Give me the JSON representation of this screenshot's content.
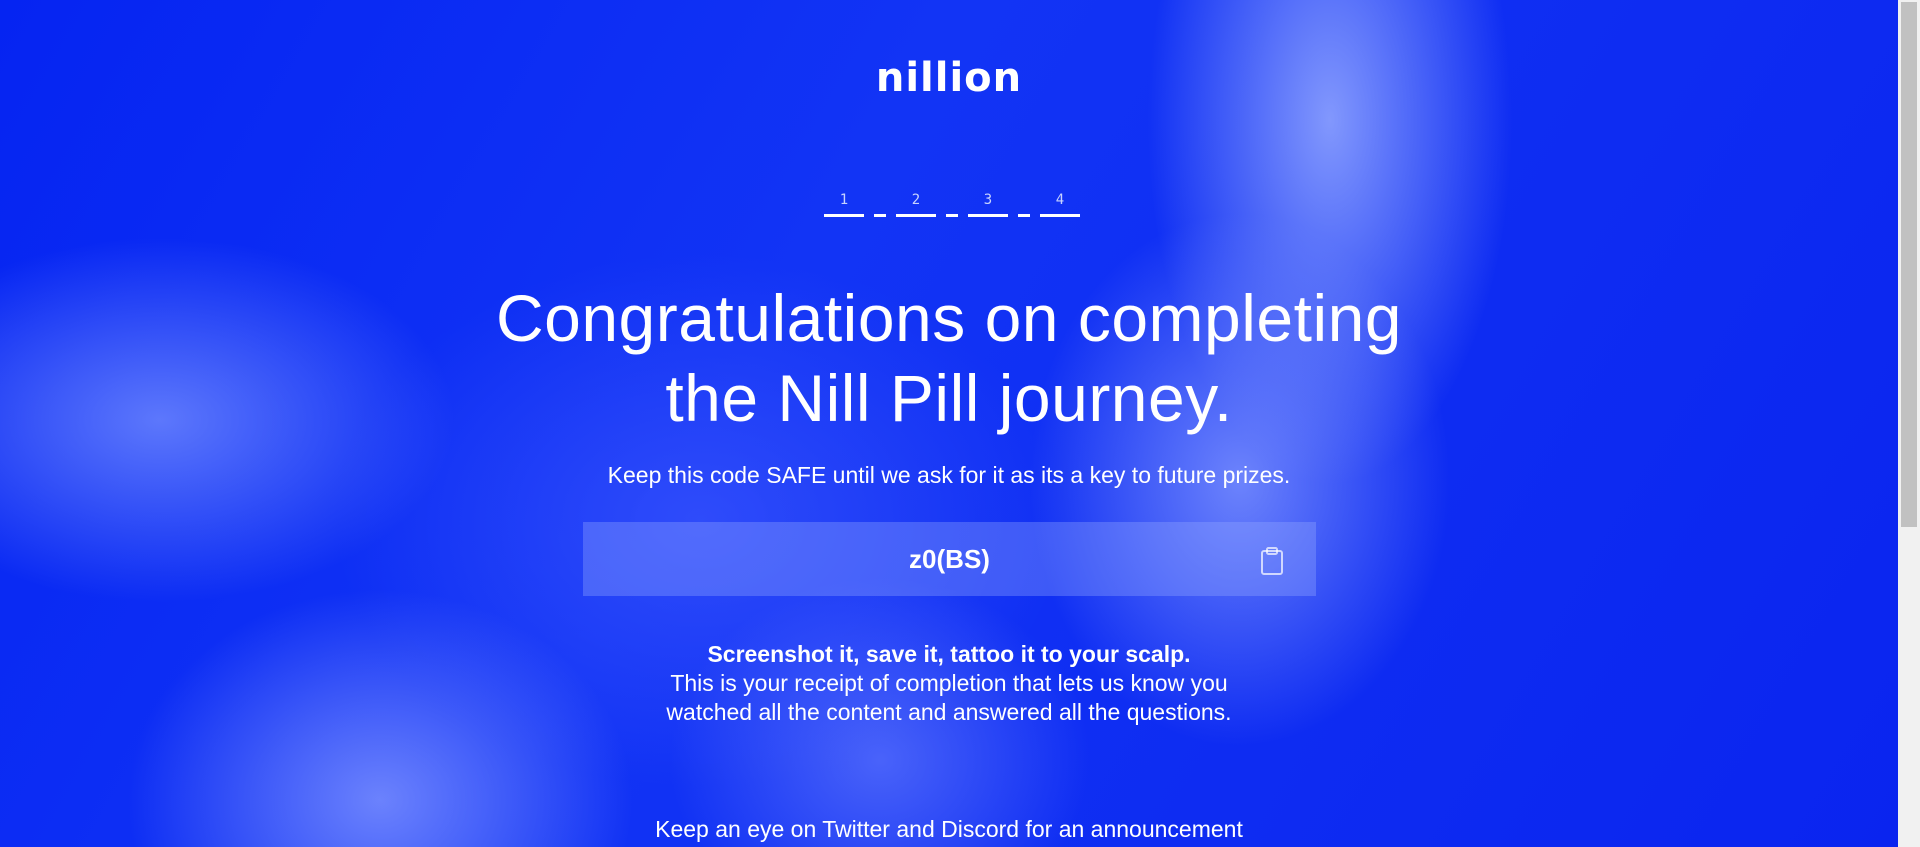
{
  "brand": {
    "logo_text": "nillion"
  },
  "progress": {
    "steps": [
      "1",
      "2",
      "3",
      "4"
    ],
    "completed_steps": 4,
    "total_steps": 4
  },
  "main": {
    "headline_line1": "Congratulations on completing",
    "headline_line2": "the Nill Pill journey.",
    "instruction": "Keep this code SAFE until we ask for it as its a key to future prizes.",
    "code": "z0(BS)",
    "receipt_bold": "Screenshot it, save it, tattoo it to your scalp.",
    "receipt_line1": "This is your receipt of completion that lets us know you",
    "receipt_line2": "watched all the content and answered all the questions.",
    "announcement": "Keep an eye on Twitter and Discord for an announcement"
  },
  "icons": {
    "copy": "clipboard-icon"
  },
  "colors": {
    "background": "#0a22f0",
    "text": "#ffffff",
    "code_box": "rgba(150,170,255,0.35)"
  }
}
